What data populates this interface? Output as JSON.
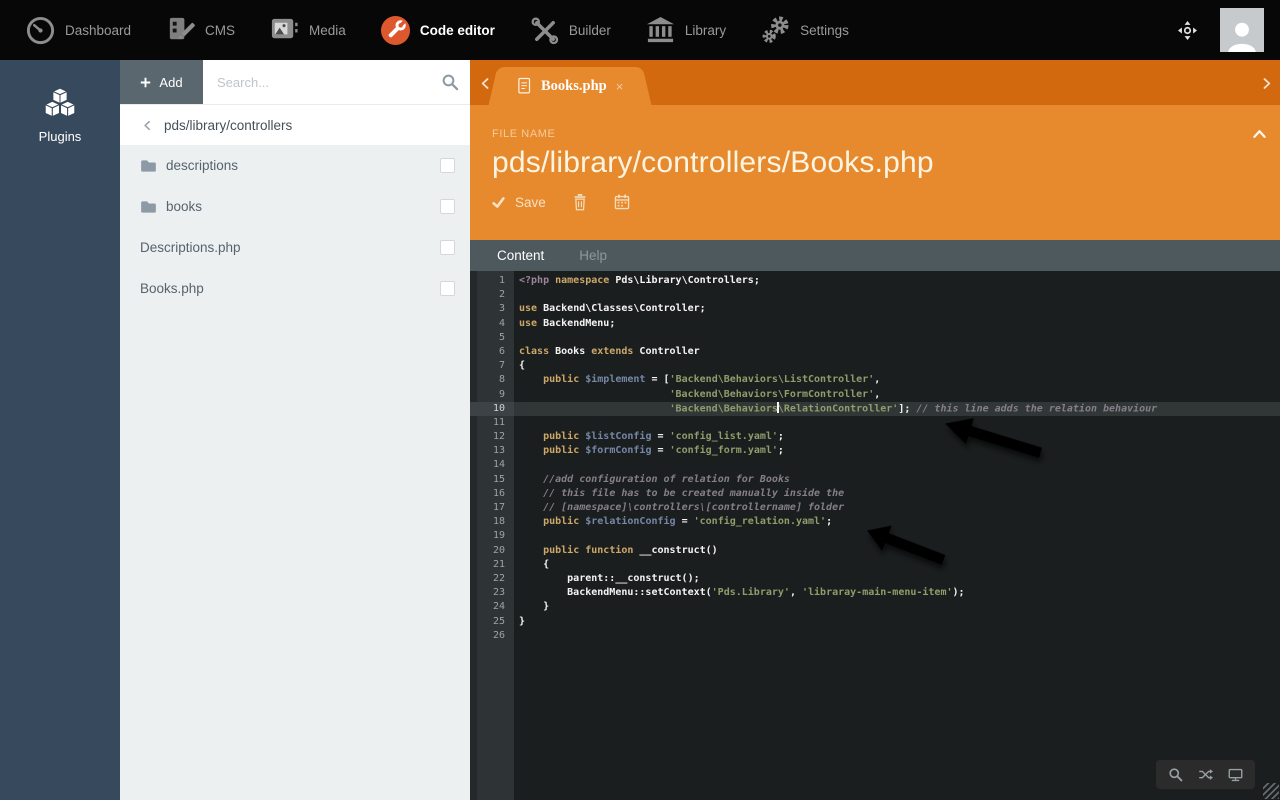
{
  "topnav": {
    "items": [
      {
        "label": "Dashboard",
        "icon": "dashboard",
        "active": false
      },
      {
        "label": "CMS",
        "icon": "cms",
        "active": false
      },
      {
        "label": "Media",
        "icon": "media",
        "active": false
      },
      {
        "label": "Code editor",
        "icon": "code-editor",
        "active": true
      },
      {
        "label": "Builder",
        "icon": "builder",
        "active": false
      },
      {
        "label": "Library",
        "icon": "library",
        "active": false
      },
      {
        "label": "Settings",
        "icon": "settings",
        "active": false
      }
    ],
    "right": {
      "move_icon": "move",
      "avatar_icon": "user-silhouette"
    }
  },
  "sidebar": {
    "items": [
      {
        "label": "Plugins",
        "icon": "plugins",
        "active": true
      }
    ]
  },
  "filepanel": {
    "add_label": "Add",
    "search_placeholder": "Search...",
    "breadcrumb": "pds/library/controllers",
    "items": [
      {
        "label": "descriptions",
        "type": "folder"
      },
      {
        "label": "books",
        "type": "folder"
      },
      {
        "label": "Descriptions.php",
        "type": "file"
      },
      {
        "label": "Books.php",
        "type": "file"
      }
    ]
  },
  "editor": {
    "tab": {
      "label": "Books.php",
      "close": "×",
      "icon": "document"
    },
    "file_name_label": "FILE NAME",
    "file_name": "pds/library/controllers/Books.php",
    "toolbar": {
      "save_label": "Save",
      "icons": [
        "check",
        "trash",
        "calendar"
      ]
    },
    "tabs": [
      {
        "label": "Content",
        "active": true
      },
      {
        "label": "Help",
        "active": false
      }
    ],
    "mini_toolbar_icons": [
      "search",
      "shuffle",
      "monitor"
    ],
    "annotations": [
      "red-arrow-to-line-10-relation-controller",
      "red-arrow-to-line-18-config-relation-yaml"
    ],
    "code": {
      "active_line": 10,
      "lines": [
        [
          [
            "p",
            "<?php "
          ],
          [
            "k",
            "namespace "
          ],
          [
            "t",
            "Pds\\Library\\Controllers;"
          ]
        ],
        [],
        [
          [
            "k",
            "use "
          ],
          [
            "t",
            "Backend\\Classes\\Controller;"
          ]
        ],
        [
          [
            "k",
            "use "
          ],
          [
            "t",
            "BackendMenu;"
          ]
        ],
        [],
        [
          [
            "k",
            "class "
          ],
          [
            "t",
            "Books "
          ],
          [
            "k",
            "extends "
          ],
          [
            "t",
            "Controller"
          ]
        ],
        [
          [
            "t",
            "{"
          ]
        ],
        [
          [
            "t",
            "    "
          ],
          [
            "k",
            "public "
          ],
          [
            "v",
            "$implement "
          ],
          [
            "t",
            "= ["
          ],
          [
            "s",
            "'Backend\\Behaviors\\ListController'"
          ],
          [
            "t",
            ","
          ]
        ],
        [
          [
            "t",
            "                         "
          ],
          [
            "s",
            "'Backend\\Behaviors\\FormController'"
          ],
          [
            "t",
            ","
          ]
        ],
        [
          [
            "t",
            "                         "
          ],
          [
            "s",
            "'Backend\\Behaviors"
          ],
          [
            "caret",
            ""
          ],
          [
            "s",
            "\\RelationController'"
          ],
          [
            "t",
            "]; "
          ],
          [
            "c",
            "// this line adds the relation behaviour"
          ]
        ],
        [],
        [
          [
            "t",
            "    "
          ],
          [
            "k",
            "public "
          ],
          [
            "v",
            "$listConfig "
          ],
          [
            "t",
            "= "
          ],
          [
            "s",
            "'config_list.yaml'"
          ],
          [
            "t",
            ";"
          ]
        ],
        [
          [
            "t",
            "    "
          ],
          [
            "k",
            "public "
          ],
          [
            "v",
            "$formConfig "
          ],
          [
            "t",
            "= "
          ],
          [
            "s",
            "'config_form.yaml'"
          ],
          [
            "t",
            ";"
          ]
        ],
        [],
        [
          [
            "t",
            "    "
          ],
          [
            "c",
            "//add configuration of relation for Books"
          ]
        ],
        [
          [
            "t",
            "    "
          ],
          [
            "c",
            "// this file has to be created manually inside the"
          ]
        ],
        [
          [
            "t",
            "    "
          ],
          [
            "c",
            "// [namespace]\\controllers\\[controllername] folder"
          ]
        ],
        [
          [
            "t",
            "    "
          ],
          [
            "k",
            "public "
          ],
          [
            "v",
            "$relationConfig "
          ],
          [
            "t",
            "= "
          ],
          [
            "s",
            "'config_relation.yaml'"
          ],
          [
            "t",
            ";"
          ]
        ],
        [],
        [
          [
            "t",
            "    "
          ],
          [
            "k",
            "public function "
          ],
          [
            "t",
            "__construct()"
          ]
        ],
        [
          [
            "t",
            "    {"
          ]
        ],
        [
          [
            "t",
            "        parent::__construct();"
          ]
        ],
        [
          [
            "t",
            "        BackendMenu::setContext("
          ],
          [
            "s",
            "'Pds.Library'"
          ],
          [
            "t",
            ", "
          ],
          [
            "s",
            "'libraray-main-menu-item'"
          ],
          [
            "t",
            ");"
          ]
        ],
        [
          [
            "t",
            "    }"
          ]
        ],
        [
          [
            "t",
            "}"
          ]
        ],
        []
      ]
    }
  },
  "colors": {
    "accent_orange": "#e7892d",
    "accent_dark_orange": "#d2690e",
    "topnav_bg": "#070707",
    "sidebar_bg": "#37495c",
    "panel_bg": "#ecf0f1",
    "tabbar_bg": "#4d595d",
    "editor_bg": "#1b1e1f",
    "gutter_bg": "#2e3436",
    "arrow_red": "#e6251c",
    "code_editor_icon_circle": "#dd582d",
    "syntax": {
      "php_tag": "#9b859d",
      "keyword": "#cda869",
      "string": "#8f9d6a",
      "variable": "#7587a6",
      "comment": "#857f87",
      "text": "#f4f4f2"
    }
  }
}
